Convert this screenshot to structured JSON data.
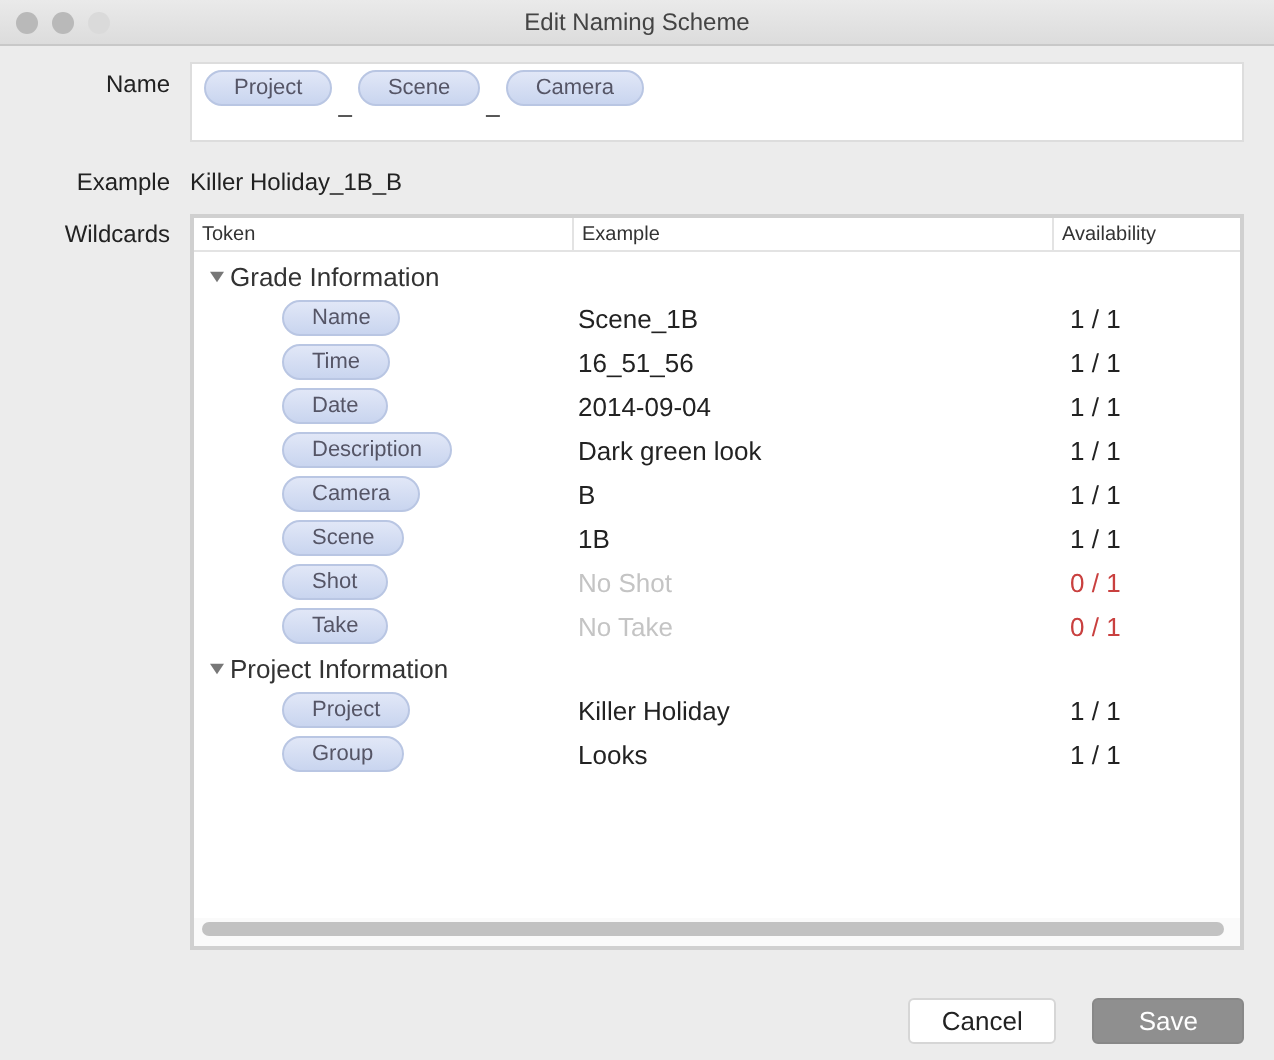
{
  "window": {
    "title": "Edit Naming Scheme"
  },
  "name": {
    "label": "Name",
    "parts": [
      {
        "kind": "token",
        "text": "Project"
      },
      {
        "kind": "separator",
        "text": "_"
      },
      {
        "kind": "token",
        "text": "Scene"
      },
      {
        "kind": "separator",
        "text": "_"
      },
      {
        "kind": "token",
        "text": "Camera"
      }
    ]
  },
  "example": {
    "label": "Example",
    "value": "Killer Holiday_1B_B"
  },
  "wildcards": {
    "label": "Wildcards",
    "columns": [
      "Token",
      "Example",
      "Availability"
    ],
    "groups": [
      {
        "title": "Grade Information",
        "expanded": true,
        "rows": [
          {
            "token": "Name",
            "example": "Scene_1B",
            "availability": "1 / 1",
            "available": true
          },
          {
            "token": "Time",
            "example": "16_51_56",
            "availability": "1 / 1",
            "available": true
          },
          {
            "token": "Date",
            "example": "2014-09-04",
            "availability": "1 / 1",
            "available": true
          },
          {
            "token": "Description",
            "example": "Dark green look",
            "availability": "1 / 1",
            "available": true
          },
          {
            "token": "Camera",
            "example": "B",
            "availability": "1 / 1",
            "available": true
          },
          {
            "token": "Scene",
            "example": "1B",
            "availability": "1 / 1",
            "available": true
          },
          {
            "token": "Shot",
            "example": "No Shot",
            "availability": "0 / 1",
            "available": false
          },
          {
            "token": "Take",
            "example": "No Take",
            "availability": "0 / 1",
            "available": false
          }
        ]
      },
      {
        "title": "Project Information",
        "expanded": true,
        "rows": [
          {
            "token": "Project",
            "example": "Killer Holiday",
            "availability": "1 / 1",
            "available": true
          },
          {
            "token": "Group",
            "example": "Looks",
            "availability": "1 / 1",
            "available": true
          }
        ]
      }
    ]
  },
  "buttons": [
    {
      "label": "Cancel",
      "disabled": false
    },
    {
      "label": "Save",
      "disabled": true
    }
  ]
}
